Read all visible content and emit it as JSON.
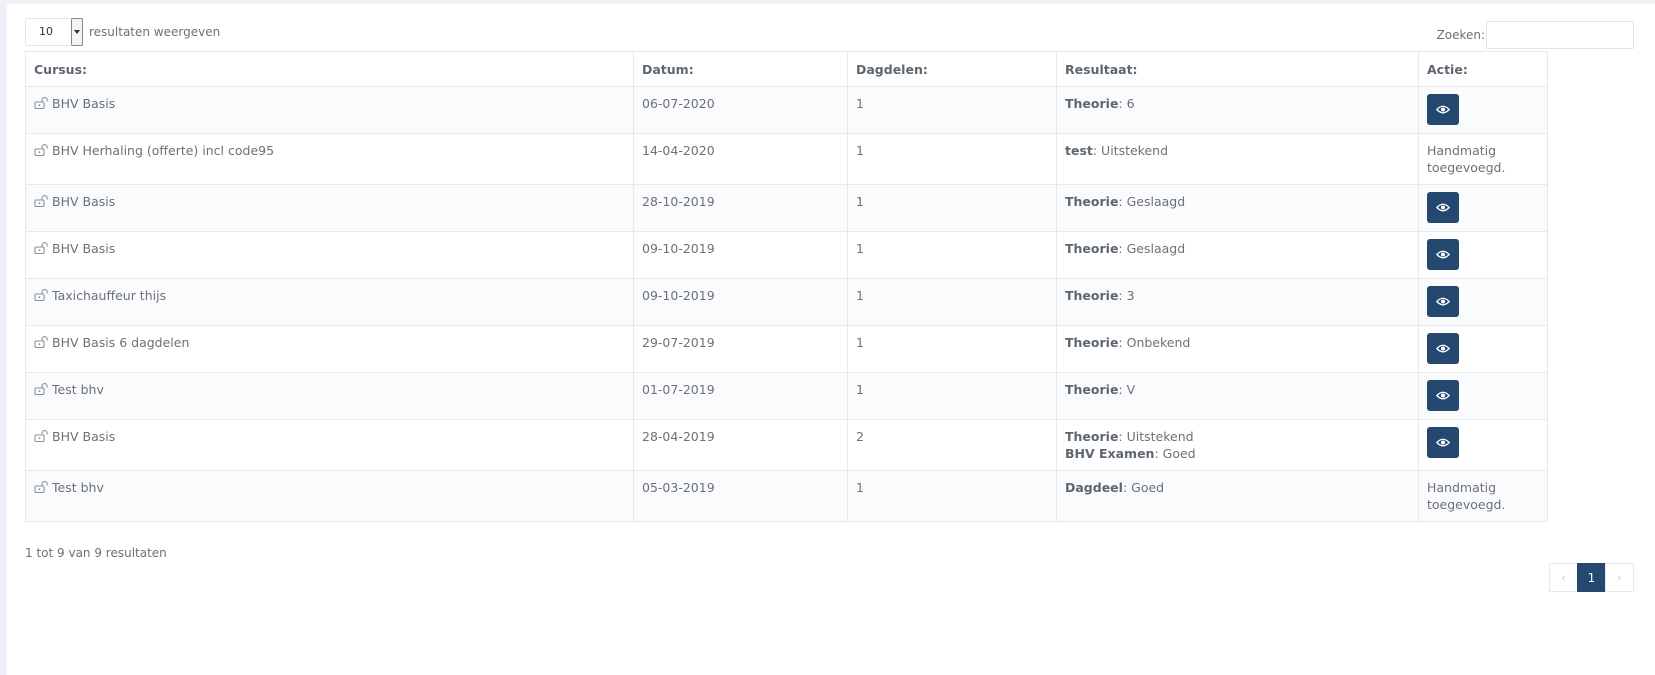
{
  "length_menu": {
    "selected": "10",
    "label": "resultaten weergeven"
  },
  "search": {
    "label": "Zoeken:",
    "value": ""
  },
  "table": {
    "headers": {
      "cursus": "Cursus:",
      "datum": "Datum:",
      "dagdelen": "Dagdelen:",
      "resultaat": "Resultaat:",
      "actie": "Actie:"
    },
    "rows": [
      {
        "cursus": "BHV Basis",
        "datum": "06-07-2020",
        "dagdelen": "1",
        "results": [
          {
            "key": "Theorie",
            "value": ": 6"
          }
        ],
        "action": {
          "type": "view",
          "text": ""
        }
      },
      {
        "cursus": "BHV Herhaling (offerte) incl code95",
        "datum": "14-04-2020",
        "dagdelen": "1",
        "results": [
          {
            "key": "test",
            "value": ": Uitstekend"
          }
        ],
        "action": {
          "type": "text",
          "text": "Handmatig toegevoegd."
        }
      },
      {
        "cursus": "BHV Basis",
        "datum": "28-10-2019",
        "dagdelen": "1",
        "results": [
          {
            "key": "Theorie",
            "value": ": Geslaagd"
          }
        ],
        "action": {
          "type": "view",
          "text": ""
        }
      },
      {
        "cursus": "BHV Basis",
        "datum": "09-10-2019",
        "dagdelen": "1",
        "results": [
          {
            "key": "Theorie",
            "value": ": Geslaagd"
          }
        ],
        "action": {
          "type": "view",
          "text": ""
        }
      },
      {
        "cursus": "Taxichauffeur thijs",
        "datum": "09-10-2019",
        "dagdelen": "1",
        "results": [
          {
            "key": "Theorie",
            "value": ": 3"
          }
        ],
        "action": {
          "type": "view",
          "text": ""
        }
      },
      {
        "cursus": "BHV Basis 6 dagdelen",
        "datum": "29-07-2019",
        "dagdelen": "1",
        "results": [
          {
            "key": "Theorie",
            "value": ": Onbekend"
          }
        ],
        "action": {
          "type": "view",
          "text": ""
        }
      },
      {
        "cursus": "Test bhv",
        "datum": "01-07-2019",
        "dagdelen": "1",
        "results": [
          {
            "key": "Theorie",
            "value": ": V"
          }
        ],
        "action": {
          "type": "view",
          "text": ""
        }
      },
      {
        "cursus": "BHV Basis",
        "datum": "28-04-2019",
        "dagdelen": "2",
        "results": [
          {
            "key": "Theorie",
            "value": ": Uitstekend"
          },
          {
            "key": "BHV Examen",
            "value": ": Goed"
          }
        ],
        "action": {
          "type": "view",
          "text": ""
        }
      },
      {
        "cursus": "Test bhv",
        "datum": "05-03-2019",
        "dagdelen": "1",
        "results": [
          {
            "key": "Dagdeel",
            "value": ": Goed"
          }
        ],
        "action": {
          "type": "text",
          "text": "Handmatig toegevoegd."
        }
      }
    ]
  },
  "info": "1 tot 9 van 9 resultaten",
  "pagination": {
    "prev": "‹",
    "current": "1",
    "next": "›"
  },
  "icons": {
    "row_icon": "unlock-icon",
    "action_icon": "eye-icon"
  },
  "colors": {
    "accent": "#244870",
    "border": "#e4eaec",
    "text": "#6c7177",
    "page_background": "#eef1f6"
  }
}
